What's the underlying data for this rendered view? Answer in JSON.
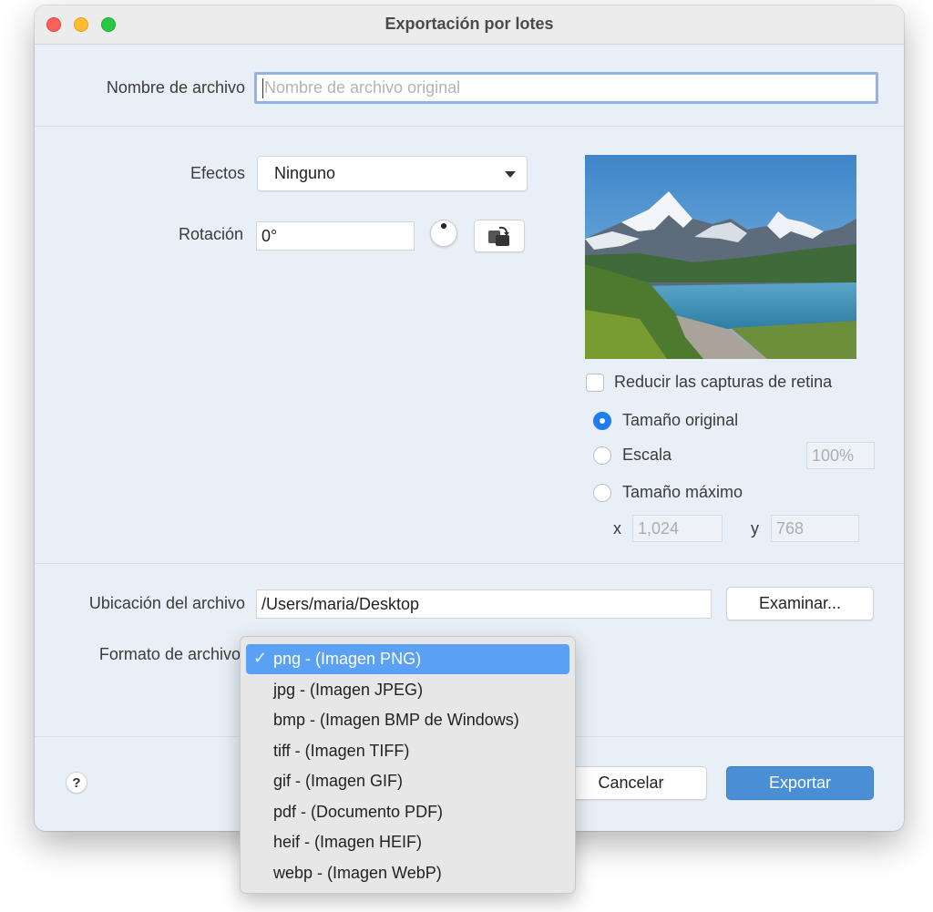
{
  "window": {
    "title": "Exportación por lotes"
  },
  "filename": {
    "label": "Nombre de archivo",
    "placeholder": "Nombre de archivo original",
    "value": ""
  },
  "effects": {
    "label": "Efectos",
    "selected": "Ninguno"
  },
  "rotation": {
    "label": "Rotación",
    "value": "0°"
  },
  "retina": {
    "label": "Reducir las capturas de retina",
    "checked": false
  },
  "size_options": {
    "original": "Tamaño original",
    "scale": "Escala",
    "scale_value": "100%",
    "max": "Tamaño máximo",
    "x_label": "x",
    "x_value": "1,024",
    "y_label": "y",
    "y_value": "768",
    "selected": "original"
  },
  "location": {
    "label": "Ubicación del archivo",
    "value": "/Users/maria/Desktop",
    "browse_label": "Examinar..."
  },
  "format": {
    "label": "Formato de archivo",
    "options": [
      "png - (Imagen PNG)",
      "jpg - (Imagen JPEG)",
      "bmp - (Imagen BMP de Windows)",
      "tiff - (Imagen TIFF)",
      "gif - (Imagen GIF)",
      "pdf - (Documento PDF)",
      "heif - (Imagen HEIF)",
      "webp - (Imagen WebP)"
    ],
    "selected_index": 0,
    "check": "✓"
  },
  "footer": {
    "help": "?",
    "cancel_label": "Cancelar",
    "export_label": "Exportar"
  },
  "colors": {
    "accent": "#1f7cf1",
    "primary_button": "#4a8fd6",
    "menu_highlight": "#5aa0f5",
    "window_bg": "#e9eff7"
  }
}
